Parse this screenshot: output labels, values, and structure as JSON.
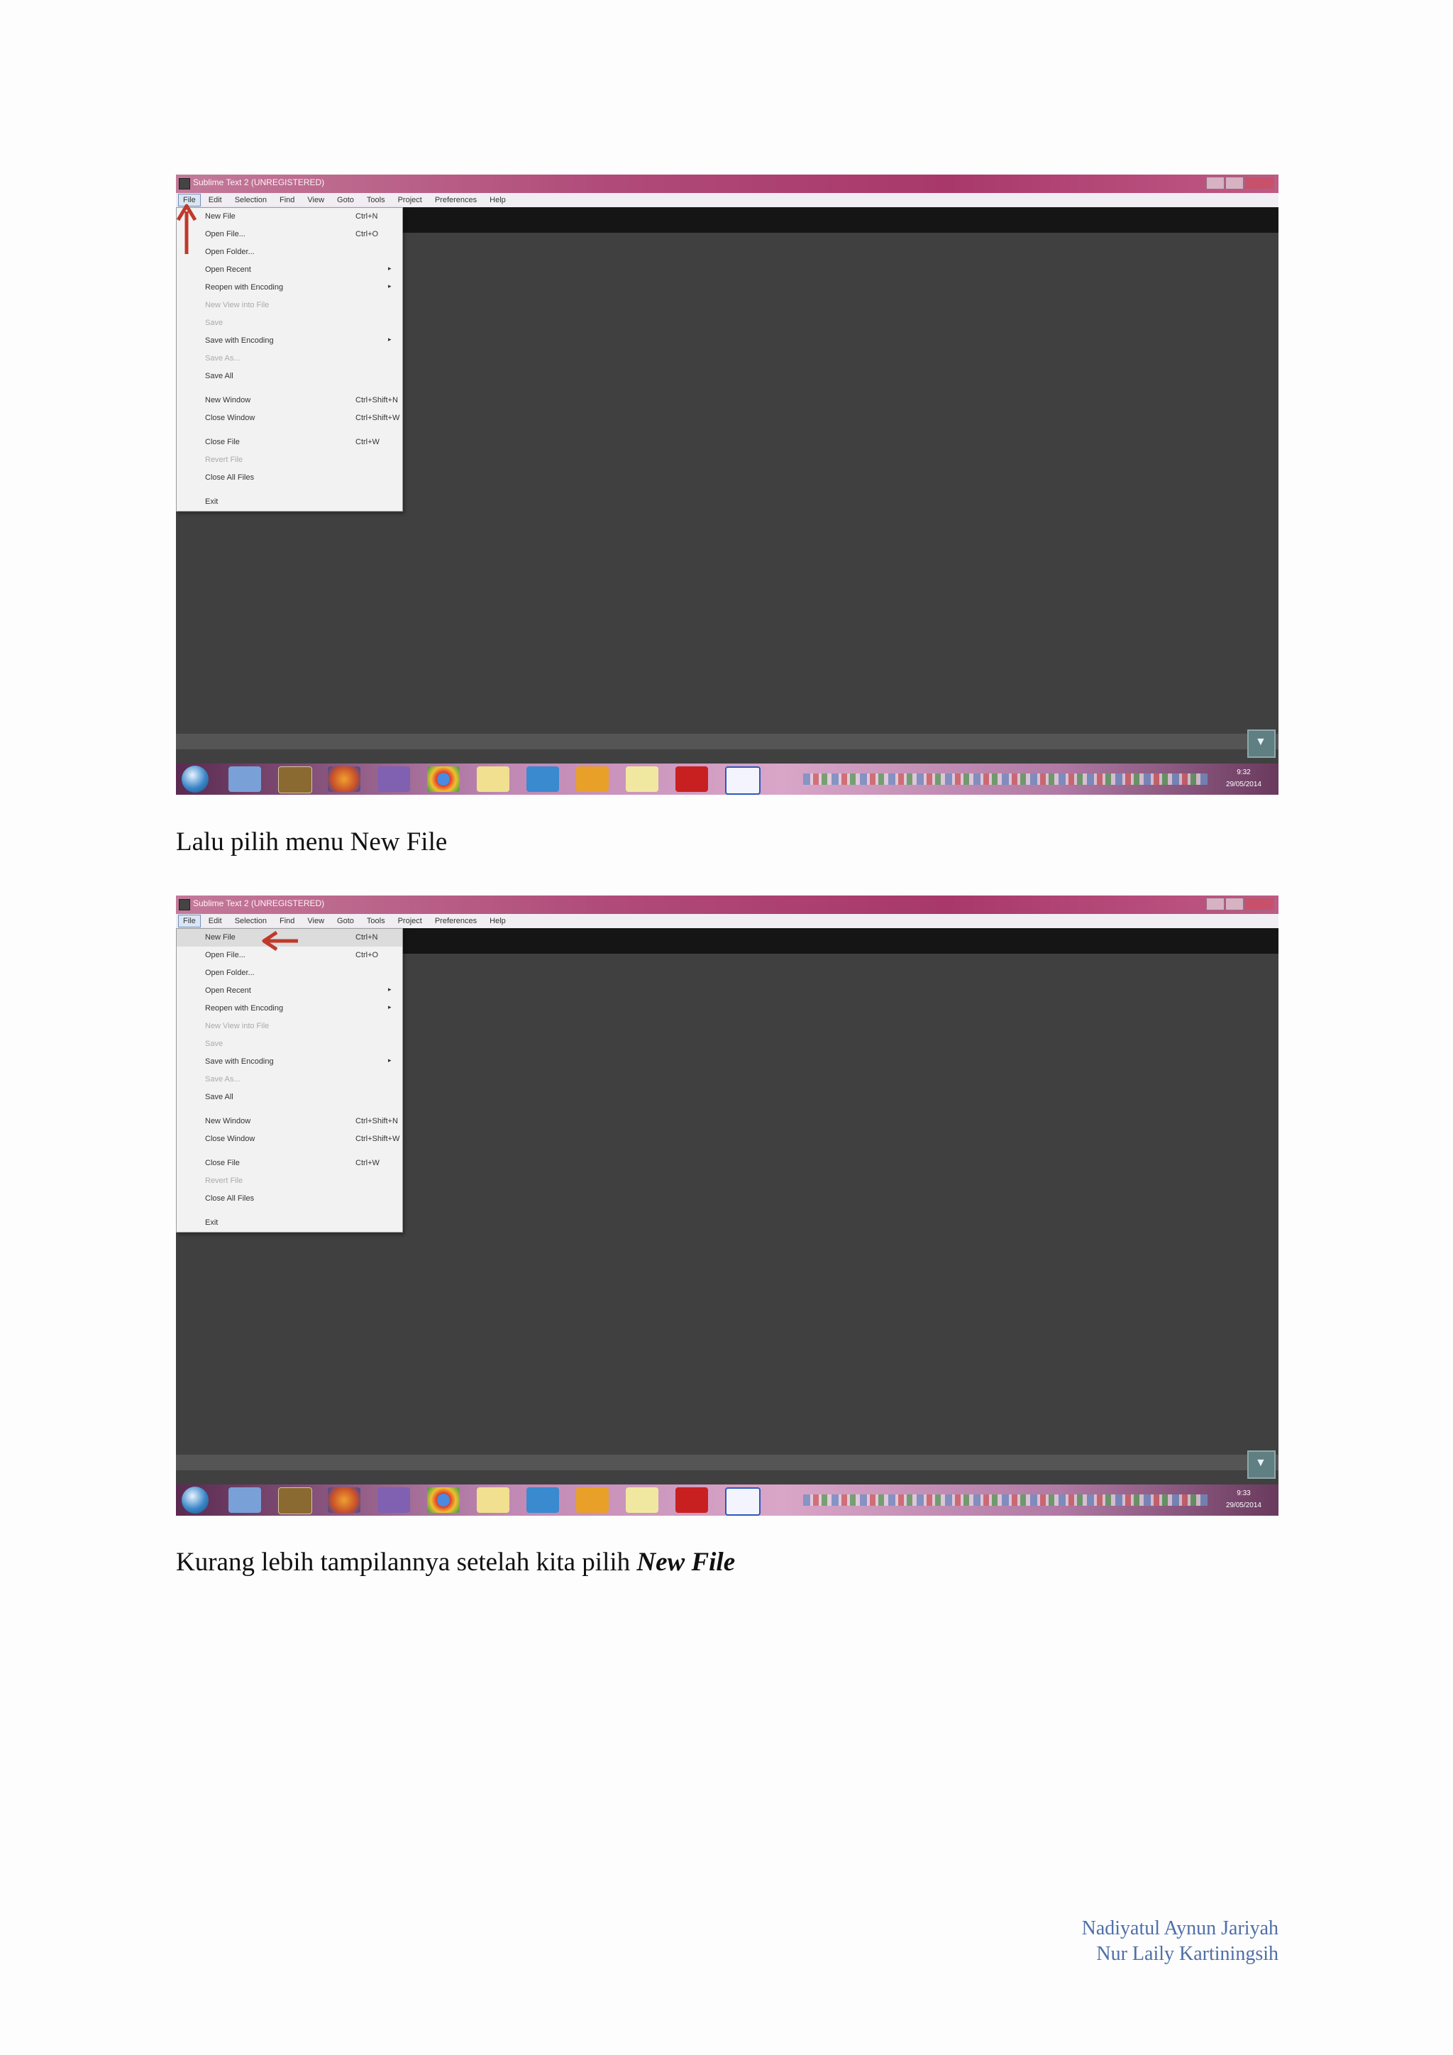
{
  "screenshots": [
    {
      "window_title": "Sublime Text 2 (UNREGISTERED)",
      "menu": [
        "File",
        "Edit",
        "Selection",
        "Find",
        "View",
        "Goto",
        "Tools",
        "Project",
        "Preferences",
        "Help"
      ],
      "file_menu": [
        {
          "label": "New File",
          "shortcut": "Ctrl+N"
        },
        {
          "label": "Open File...",
          "shortcut": "Ctrl+O"
        },
        {
          "label": "Open Folder..."
        },
        {
          "label": "Open Recent",
          "arrow": "▸"
        },
        {
          "label": "Reopen with Encoding",
          "arrow": "▸"
        },
        {
          "label": "New View into File"
        },
        {
          "label": "Save"
        },
        {
          "label": "Save with Encoding",
          "arrow": "▸"
        },
        {
          "label": "Save As..."
        },
        {
          "label": "Save All"
        },
        {
          "label": "New Window",
          "shortcut": "Ctrl+Shift+N"
        },
        {
          "label": "Close Window",
          "shortcut": "Ctrl+Shift+W"
        },
        {
          "label": "Close File",
          "shortcut": "Ctrl+W"
        },
        {
          "label": "Revert File"
        },
        {
          "label": "Close All Files"
        },
        {
          "label": "Exit"
        }
      ],
      "clock_time": "9:32",
      "clock_date": "29/05/2014"
    },
    {
      "window_title": "Sublime Text 2 (UNREGISTERED)",
      "menu": [
        "File",
        "Edit",
        "Selection",
        "Find",
        "View",
        "Goto",
        "Tools",
        "Project",
        "Preferences",
        "Help"
      ],
      "file_menu": [
        {
          "label": "New File",
          "shortcut": "Ctrl+N"
        },
        {
          "label": "Open File...",
          "shortcut": "Ctrl+O"
        },
        {
          "label": "Open Folder..."
        },
        {
          "label": "Open Recent",
          "arrow": "▸"
        },
        {
          "label": "Reopen with Encoding",
          "arrow": "▸"
        },
        {
          "label": "New View into File"
        },
        {
          "label": "Save"
        },
        {
          "label": "Save with Encoding",
          "arrow": "▸"
        },
        {
          "label": "Save As..."
        },
        {
          "label": "Save All"
        },
        {
          "label": "New Window",
          "shortcut": "Ctrl+Shift+N"
        },
        {
          "label": "Close Window",
          "shortcut": "Ctrl+Shift+W"
        },
        {
          "label": "Close File",
          "shortcut": "Ctrl+W"
        },
        {
          "label": "Revert File"
        },
        {
          "label": "Close All Files"
        },
        {
          "label": "Exit"
        }
      ],
      "clock_time": "9:33",
      "clock_date": "29/05/2014"
    }
  ],
  "captions": {
    "first": "Lalu pilih menu New File",
    "second_prefix": "Kurang lebih tampilannya setelah kita pilih ",
    "second_emphasis": "New File"
  },
  "footer": {
    "author1": "Nadiyatul Aynun Jariyah",
    "author2": "Nur Laily Kartiningsih"
  },
  "colors": {
    "titlebar_accent": "#b04a78",
    "editor_bg": "#404040",
    "annotation_arrow": "#c0392b",
    "footer_text": "#4f6fa8"
  }
}
